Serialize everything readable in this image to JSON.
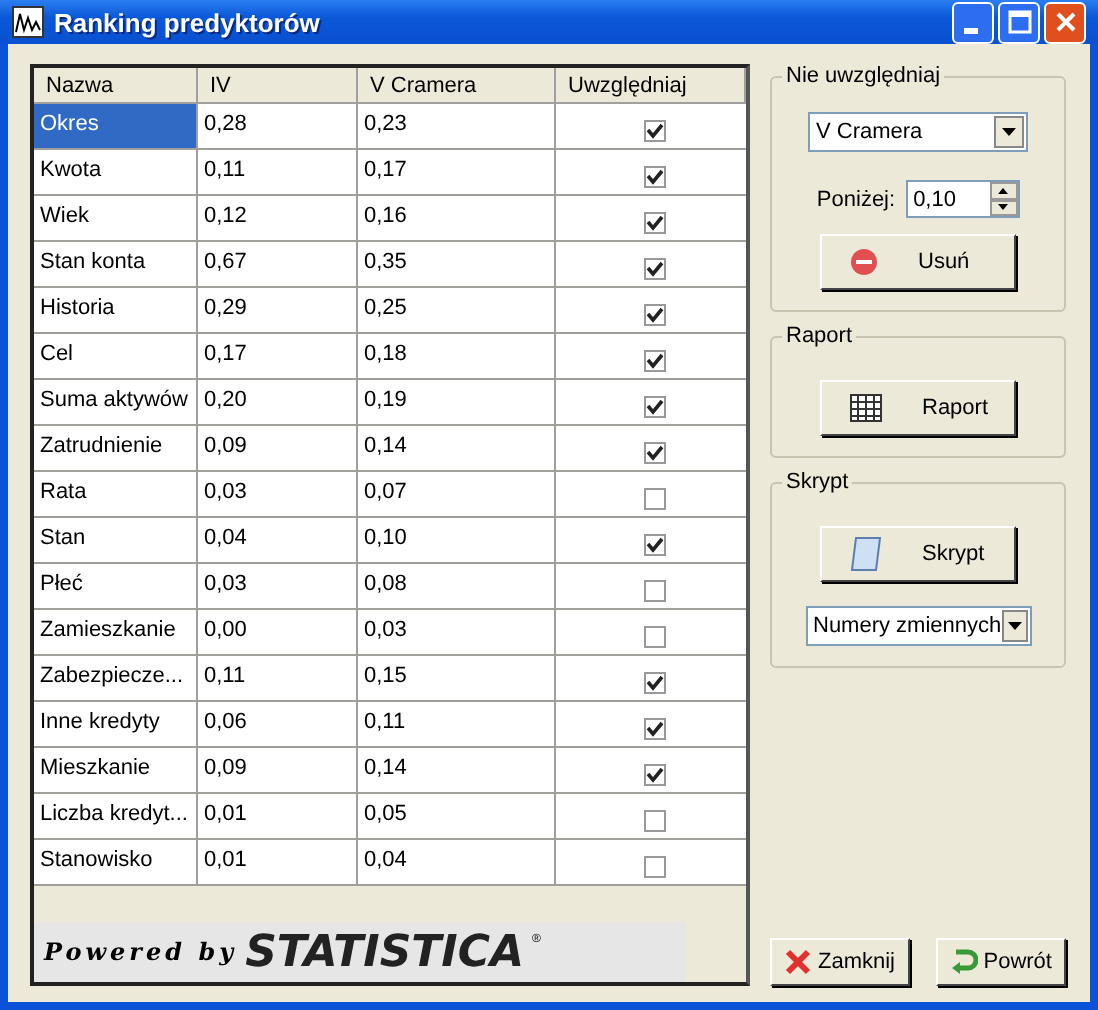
{
  "window": {
    "title": "Ranking predyktorów"
  },
  "table": {
    "columns": [
      "Nazwa",
      "IV",
      "V Cramera",
      "Uwzględniaj"
    ],
    "rows": [
      {
        "name": "Okres",
        "iv": "0,28",
        "v": "0,23",
        "checked": true,
        "selected": true
      },
      {
        "name": "Kwota",
        "iv": "0,11",
        "v": "0,17",
        "checked": true,
        "selected": false
      },
      {
        "name": "Wiek",
        "iv": "0,12",
        "v": "0,16",
        "checked": true,
        "selected": false
      },
      {
        "name": "Stan konta",
        "iv": "0,67",
        "v": "0,35",
        "checked": true,
        "selected": false
      },
      {
        "name": "Historia",
        "iv": "0,29",
        "v": "0,25",
        "checked": true,
        "selected": false
      },
      {
        "name": "Cel",
        "iv": "0,17",
        "v": "0,18",
        "checked": true,
        "selected": false
      },
      {
        "name": "Suma aktywów",
        "iv": "0,20",
        "v": "0,19",
        "checked": true,
        "selected": false
      },
      {
        "name": "Zatrudnienie",
        "iv": "0,09",
        "v": "0,14",
        "checked": true,
        "selected": false
      },
      {
        "name": "Rata",
        "iv": "0,03",
        "v": "0,07",
        "checked": false,
        "selected": false
      },
      {
        "name": "Stan",
        "iv": "0,04",
        "v": "0,10",
        "checked": true,
        "selected": false
      },
      {
        "name": "Płeć",
        "iv": "0,03",
        "v": "0,08",
        "checked": false,
        "selected": false
      },
      {
        "name": "Zamieszkanie",
        "iv": "0,00",
        "v": "0,03",
        "checked": false,
        "selected": false
      },
      {
        "name": "Zabezpiecze...",
        "iv": "0,11",
        "v": "0,15",
        "checked": true,
        "selected": false
      },
      {
        "name": "Inne kredyty",
        "iv": "0,06",
        "v": "0,11",
        "checked": true,
        "selected": false
      },
      {
        "name": "Mieszkanie",
        "iv": "0,09",
        "v": "0,14",
        "checked": true,
        "selected": false
      },
      {
        "name": "Liczba kredyt...",
        "iv": "0,01",
        "v": "0,05",
        "checked": false,
        "selected": false
      },
      {
        "name": "Stanowisko",
        "iv": "0,01",
        "v": "0,04",
        "checked": false,
        "selected": false
      }
    ]
  },
  "logo": {
    "prefix": "Powered by",
    "brand": "STATISTICA",
    "mark": "®"
  },
  "exclude_group": {
    "title": "Nie uwzględniaj",
    "criterion": "V Cramera",
    "threshold_label": "Poniżej:",
    "threshold": "0,10",
    "button": "Usuń"
  },
  "report_group": {
    "title": "Raport",
    "button": "Raport"
  },
  "script_group": {
    "title": "Skrypt",
    "button": "Skrypt",
    "option": "Numery zmiennych"
  },
  "buttons": [
    {
      "kind": "close",
      "label": "Zamknij"
    },
    {
      "kind": "back",
      "label": "Powrót"
    }
  ]
}
